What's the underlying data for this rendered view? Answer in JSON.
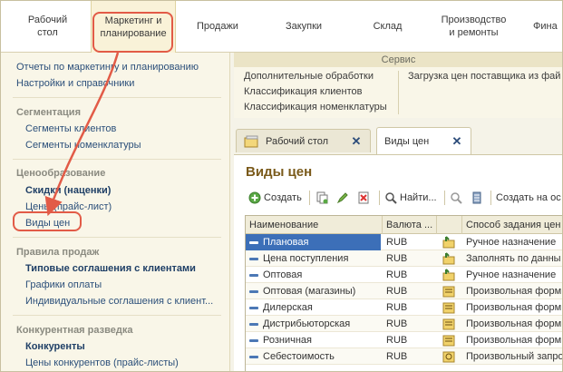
{
  "top_menu": [
    {
      "label": "Рабочий\nстол"
    },
    {
      "label": "Маркетинг и\nпланирование"
    },
    {
      "label": "Продажи"
    },
    {
      "label": "Закупки"
    },
    {
      "label": "Склад"
    },
    {
      "label": "Производство\nи ремонты"
    },
    {
      "label": "Фина"
    }
  ],
  "sidebar": {
    "top_links": [
      "Отчеты по маркетингу и планированию",
      "Настройки и справочники"
    ],
    "segmentation": {
      "heading": "Сегментация",
      "items": [
        "Сегменты клиентов",
        "Сегменты номенклатуры"
      ]
    },
    "pricing": {
      "heading": "Ценообразование",
      "items": [
        "Скидки (наценки)",
        "Цены (прайс-лист)",
        "Виды цен"
      ]
    },
    "sales_rules": {
      "heading": "Правила продаж",
      "items": [
        "Типовые соглашения с клиентами",
        "Графики оплаты",
        "Индивидуальные соглашения с клиент..."
      ]
    },
    "competitors": {
      "heading": "Конкурентная разведка",
      "items": [
        "Конкуренты",
        "Цены конкурентов (прайс-листы)"
      ]
    }
  },
  "service": {
    "title": "Сервис",
    "col1": [
      "Дополнительные обработки",
      "Классификация клиентов",
      "Классификация номенклатуры"
    ],
    "col2": [
      "Загрузка цен поставщика из фай"
    ]
  },
  "doc_tabs": [
    {
      "label": "Рабочий стол"
    },
    {
      "label": "Виды цен"
    }
  ],
  "content": {
    "title": "Виды цен",
    "toolbar": {
      "create": "Создать",
      "find": "Найти...",
      "create_based": "Создать на ос"
    },
    "columns": [
      "Наименование",
      "Валюта ...",
      "",
      "Способ задания цен"
    ],
    "rows": [
      {
        "name": "Плановая",
        "currency": "RUB",
        "method": "Ручное назначение"
      },
      {
        "name": "Цена поступления",
        "currency": "RUB",
        "method": "Заполнять по данны"
      },
      {
        "name": "Оптовая",
        "currency": "RUB",
        "method": "Ручное назначение"
      },
      {
        "name": "Оптовая (магазины)",
        "currency": "RUB",
        "method": "Произвольная форм"
      },
      {
        "name": "Дилерская",
        "currency": "RUB",
        "method": "Произвольная форм"
      },
      {
        "name": "Дистрибьюторская",
        "currency": "RUB",
        "method": "Произвольная форм"
      },
      {
        "name": "Розничная",
        "currency": "RUB",
        "method": "Произвольная форм"
      },
      {
        "name": "Себестоимость",
        "currency": "RUB",
        "method": "Произвольный запро"
      }
    ]
  },
  "colors": {
    "accent_red": "#e25b47",
    "link_blue": "#2b4f7a",
    "title_brown": "#7a5a1a",
    "selection": "#3c6fb8"
  }
}
